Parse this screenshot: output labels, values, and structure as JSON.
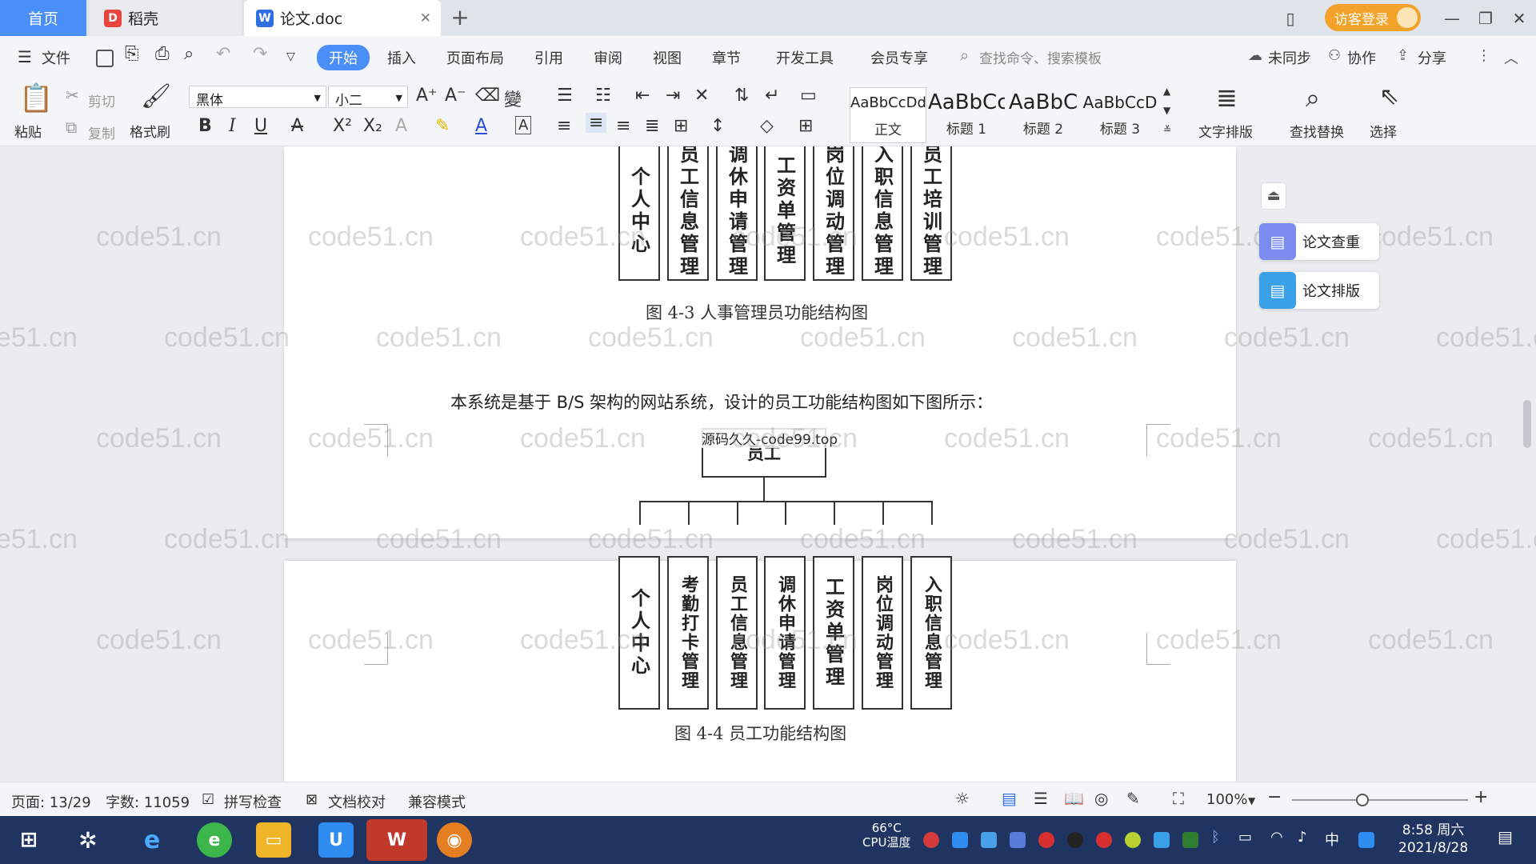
{
  "tabs": {
    "home": "首页",
    "daoke": "稻壳",
    "doc": "论文.doc",
    "add": "+"
  },
  "titlebar": {
    "login": "访客登录"
  },
  "menu": {
    "file": "文件",
    "items": [
      "开始",
      "插入",
      "页面布局",
      "引用",
      "审阅",
      "视图",
      "章节",
      "开发工具",
      "会员专享"
    ],
    "search": "查找命令、搜索模板",
    "sync": "未同步",
    "collab": "协作",
    "share": "分享"
  },
  "ribbon": {
    "paste": "粘贴",
    "cut": "剪切",
    "copy": "复制",
    "format_painter": "格式刷",
    "font_name": "黑体",
    "font_size": "小二",
    "styles": [
      {
        "sample": "AaBbCcDd",
        "name": "正文"
      },
      {
        "sample": "AaBbCc",
        "name": "标题 1"
      },
      {
        "sample": "AaBbC",
        "name": "标题 2"
      },
      {
        "sample": "AaBbCcD",
        "name": "标题 3"
      }
    ],
    "text_layout": "文字排版",
    "find_replace": "查找替换",
    "select": "选择"
  },
  "document": {
    "fig3_boxes": [
      "个人中心",
      "员工信息管理",
      "调休申请管理",
      "工资单管理",
      "岗位调动管理",
      "入职信息管理",
      "员工培训管理"
    ],
    "fig3_caption": "图 4-3  人事管理员功能结构图",
    "paragraph": "本系统是基于 B/S 架构的网站系统，设计的员工功能结构图如下图所示：",
    "overlay_text": "源码久久-code99.top",
    "root_label": "员工",
    "fig4_boxes": [
      "个人中心",
      "考勤打卡管理",
      "员工信息管理",
      "调休申请管理",
      "工资单管理",
      "岗位调动管理",
      "入职信息管理"
    ],
    "fig4_caption": "图 4-4  员工功能结构图",
    "watermark": "code51.cn"
  },
  "sidepanel": {
    "check": "论文查重",
    "layout": "论文排版"
  },
  "status": {
    "page": "页面: 13/29",
    "words": "字数: 11059",
    "spell": "拼写检查",
    "proof": "文档校对",
    "compat": "兼容模式",
    "zoom": "100%",
    "zoom_level": 0.4
  },
  "taskbar": {
    "cpu_temp": "66°C",
    "cpu_label": "CPU温度",
    "ime": "中",
    "time": "8:58 周六",
    "date": "2021/8/28"
  }
}
